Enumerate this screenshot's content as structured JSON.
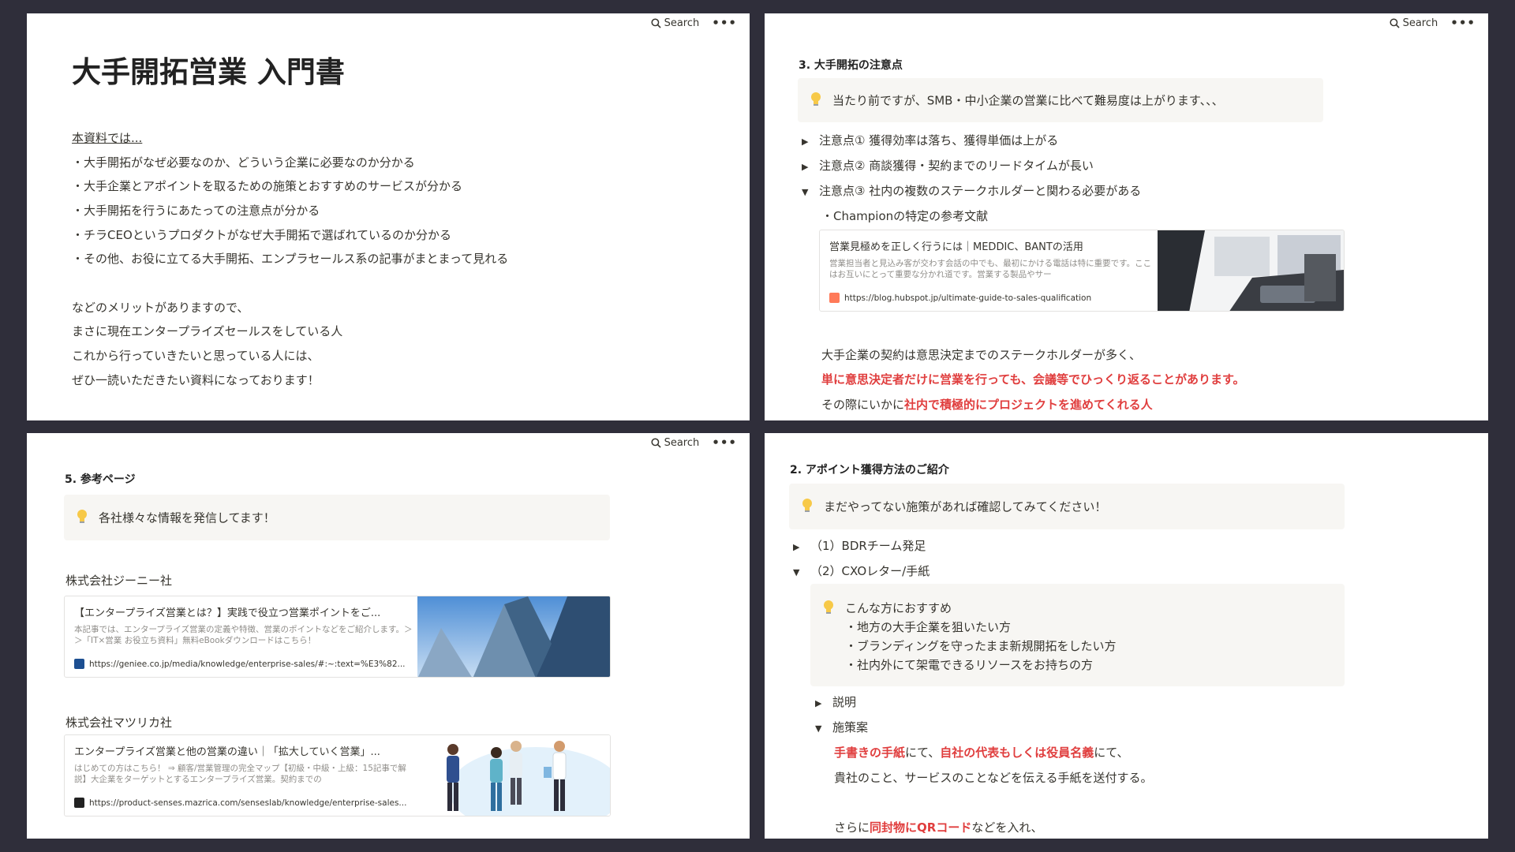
{
  "common": {
    "search_label": "Search",
    "more_label": "•••"
  },
  "panel1": {
    "title": "大手開拓営業 入門書",
    "intro": "本資料では...",
    "bullets": [
      "・大手開拓がなぜ必要なのか、どういう企業に必要なのか分かる",
      "・大手企業とアポイントを取るための施策とおすすめのサービスが分かる",
      "・大手開拓を行うにあたっての注意点が分かる",
      "・チラCEOというプロダクトがなぜ大手開拓で選ばれているのか分かる",
      "・その他、お役に立てる大手開拓、エンプラセールス系の記事がまとまって見れる"
    ],
    "closing": [
      "などのメリットがありますので、",
      "まさに現在エンタープライズセールスをしている人",
      "これから行っていきたいと思っている人には、",
      "ぜひ一読いただきたい資料になっております！"
    ]
  },
  "panel2": {
    "heading": "3. 大手開拓の注意点",
    "callout": "当たり前ですが、SMB・中小企業の営業に比べて難易度は上がります、、、",
    "toggles": [
      {
        "arrow": "▶",
        "label": "注意点① 獲得効率は落ち、獲得単価は上がる"
      },
      {
        "arrow": "▶",
        "label": "注意点② 商談獲得・契約までのリードタイムが長い"
      },
      {
        "arrow": "▼",
        "label": "注意点③ 社内の複数のステークホルダーと関わる必要がある"
      }
    ],
    "sub_label": "・Championの特定の参考文献",
    "bookmark": {
      "title": "営業見極めを正しく行うには｜MEDDIC、BANTの活用",
      "desc": "営業担当者と見込み客が交わす会話の中でも、最初にかける電話は特に重要です。ここはお互いにとって重要な分かれ道です。営業する製品やサー",
      "url": "https://blog.hubspot.jp/ultimate-guide-to-sales-qualification"
    },
    "body1": "大手企業の契約は意思決定までのステークホルダーが多く、",
    "body2": "単に意思決定者だけに営業を行っても、会議等でひっくり返ることがあります。",
    "body3_plain": "その際にいかに",
    "body3_red": "社内で積極的にプロジェクトを進めてくれる人"
  },
  "panel3": {
    "heading": "5. 参考ページ",
    "callout": "各社様々な情報を発信してます！",
    "company1": "株式会社ジーニー社",
    "bookmark1": {
      "title": "【エンタープライズ営業とは？】実践で役立つ営業ポイントをご...",
      "desc": "本記事では、エンタープライズ営業の定義や特徴、営業のポイントなどをご紹介します。＞＞「IT×営業 お役立ち資料」無料eBookダウンロードはこちら！",
      "url": "https://geniee.co.jp/media/knowledge/enterprise-sales/#:~:text=%E3%82..."
    },
    "company2": "株式会社マツリカ社",
    "bookmark2": {
      "title": "エンタープライズ営業と他の営業の違い｜「拡大していく営業」...",
      "desc": "はじめての方はこちら！ ⇒ 顧客/営業管理の完全マップ【初級・中級・上級：15記事で解説】大企業をターゲットとするエンタープライズ営業。契約までの",
      "url": "https://product-senses.mazrica.com/senseslab/knowledge/enterprise-sales..."
    }
  },
  "panel4": {
    "heading": "2. アポイント獲得方法のご紹介",
    "callout": "まだやってない施策があれば確認してみてください！",
    "toggles": [
      {
        "arrow": "▶",
        "label": "（1）BDRチーム発足"
      },
      {
        "arrow": "▼",
        "label": "（2）CXOレター/手紙"
      }
    ],
    "inner_callout": {
      "title": "こんな方におすすめ",
      "items": [
        "・地方の大手企業を狙いたい方",
        "・ブランディングを守ったまま新規開拓をしたい方",
        "・社内外にて架電できるリソースをお持ちの方"
      ]
    },
    "sub_toggles": [
      {
        "arrow": "▶",
        "label": "説明"
      },
      {
        "arrow": "▼",
        "label": "施策案"
      }
    ],
    "line1": {
      "red1": "手書きの手紙",
      "plain1": "にて、",
      "red2": "自社の代表もしくは役員名義",
      "plain2": "にて、"
    },
    "line2": "貴社のこと、サービスのことなどを伝える手紙を送付する。",
    "line3": {
      "plain1": "さらに",
      "red1": "同封物にQRコード",
      "plain2": "などを入れ、"
    }
  },
  "colors": {
    "background": "#2f2e3a",
    "panel": "#ffffff",
    "callout": "#f7f6f3",
    "accent_red": "#e03e3e"
  },
  "icons": [
    "search-icon",
    "more-icon",
    "lightbulb-icon",
    "toggle-arrow-icon",
    "favicon-icon"
  ]
}
